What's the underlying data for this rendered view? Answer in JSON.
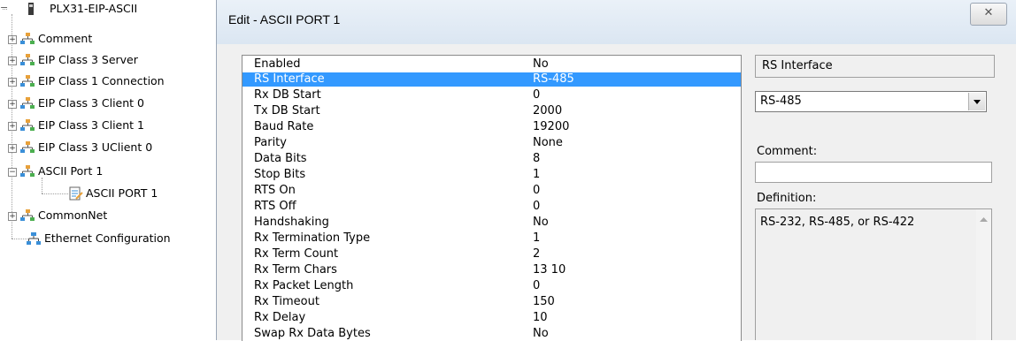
{
  "tree": {
    "root": "PLX31-EIP-ASCII",
    "nodes": [
      {
        "label": "Comment"
      },
      {
        "label": "EIP Class 3 Server"
      },
      {
        "label": "EIP Class 1 Connection"
      },
      {
        "label": "EIP Class 3 Client 0"
      },
      {
        "label": "EIP Class 3 Client 1"
      },
      {
        "label": "EIP Class 3 UClient 0"
      },
      {
        "label": "ASCII Port 1"
      },
      {
        "label": "ASCII PORT 1"
      },
      {
        "label": "CommonNet"
      },
      {
        "label": "Ethernet Configuration"
      }
    ]
  },
  "dialog": {
    "title": "Edit - ASCII PORT 1",
    "close_glyph": "✕",
    "properties": [
      {
        "name": "Enabled",
        "value": "No"
      },
      {
        "name": "RS Interface",
        "value": "RS-485"
      },
      {
        "name": "Rx DB Start",
        "value": "0"
      },
      {
        "name": "Tx DB Start",
        "value": "2000"
      },
      {
        "name": "Baud Rate",
        "value": "19200"
      },
      {
        "name": "Parity",
        "value": "None"
      },
      {
        "name": "Data Bits",
        "value": "8"
      },
      {
        "name": "Stop Bits",
        "value": "1"
      },
      {
        "name": "RTS On",
        "value": "0"
      },
      {
        "name": "RTS Off",
        "value": "0"
      },
      {
        "name": "Handshaking",
        "value": "No"
      },
      {
        "name": "Rx Termination Type",
        "value": "1"
      },
      {
        "name": "Rx Term Count",
        "value": "2"
      },
      {
        "name": "Rx Term Chars",
        "value": "13 10"
      },
      {
        "name": "Rx Packet Length",
        "value": "0"
      },
      {
        "name": "Rx Timeout",
        "value": "150"
      },
      {
        "name": "Rx Delay",
        "value": "10"
      },
      {
        "name": "Swap Rx Data Bytes",
        "value": "No"
      }
    ],
    "selected_property_index": 1,
    "field_name": "RS Interface",
    "field_value": "RS-485",
    "comment_label": "Comment:",
    "comment_value": "",
    "definition_label": "Definition:",
    "definition_text": "RS-232, RS-485, or RS-422",
    "selection_color": "#3399ff"
  }
}
